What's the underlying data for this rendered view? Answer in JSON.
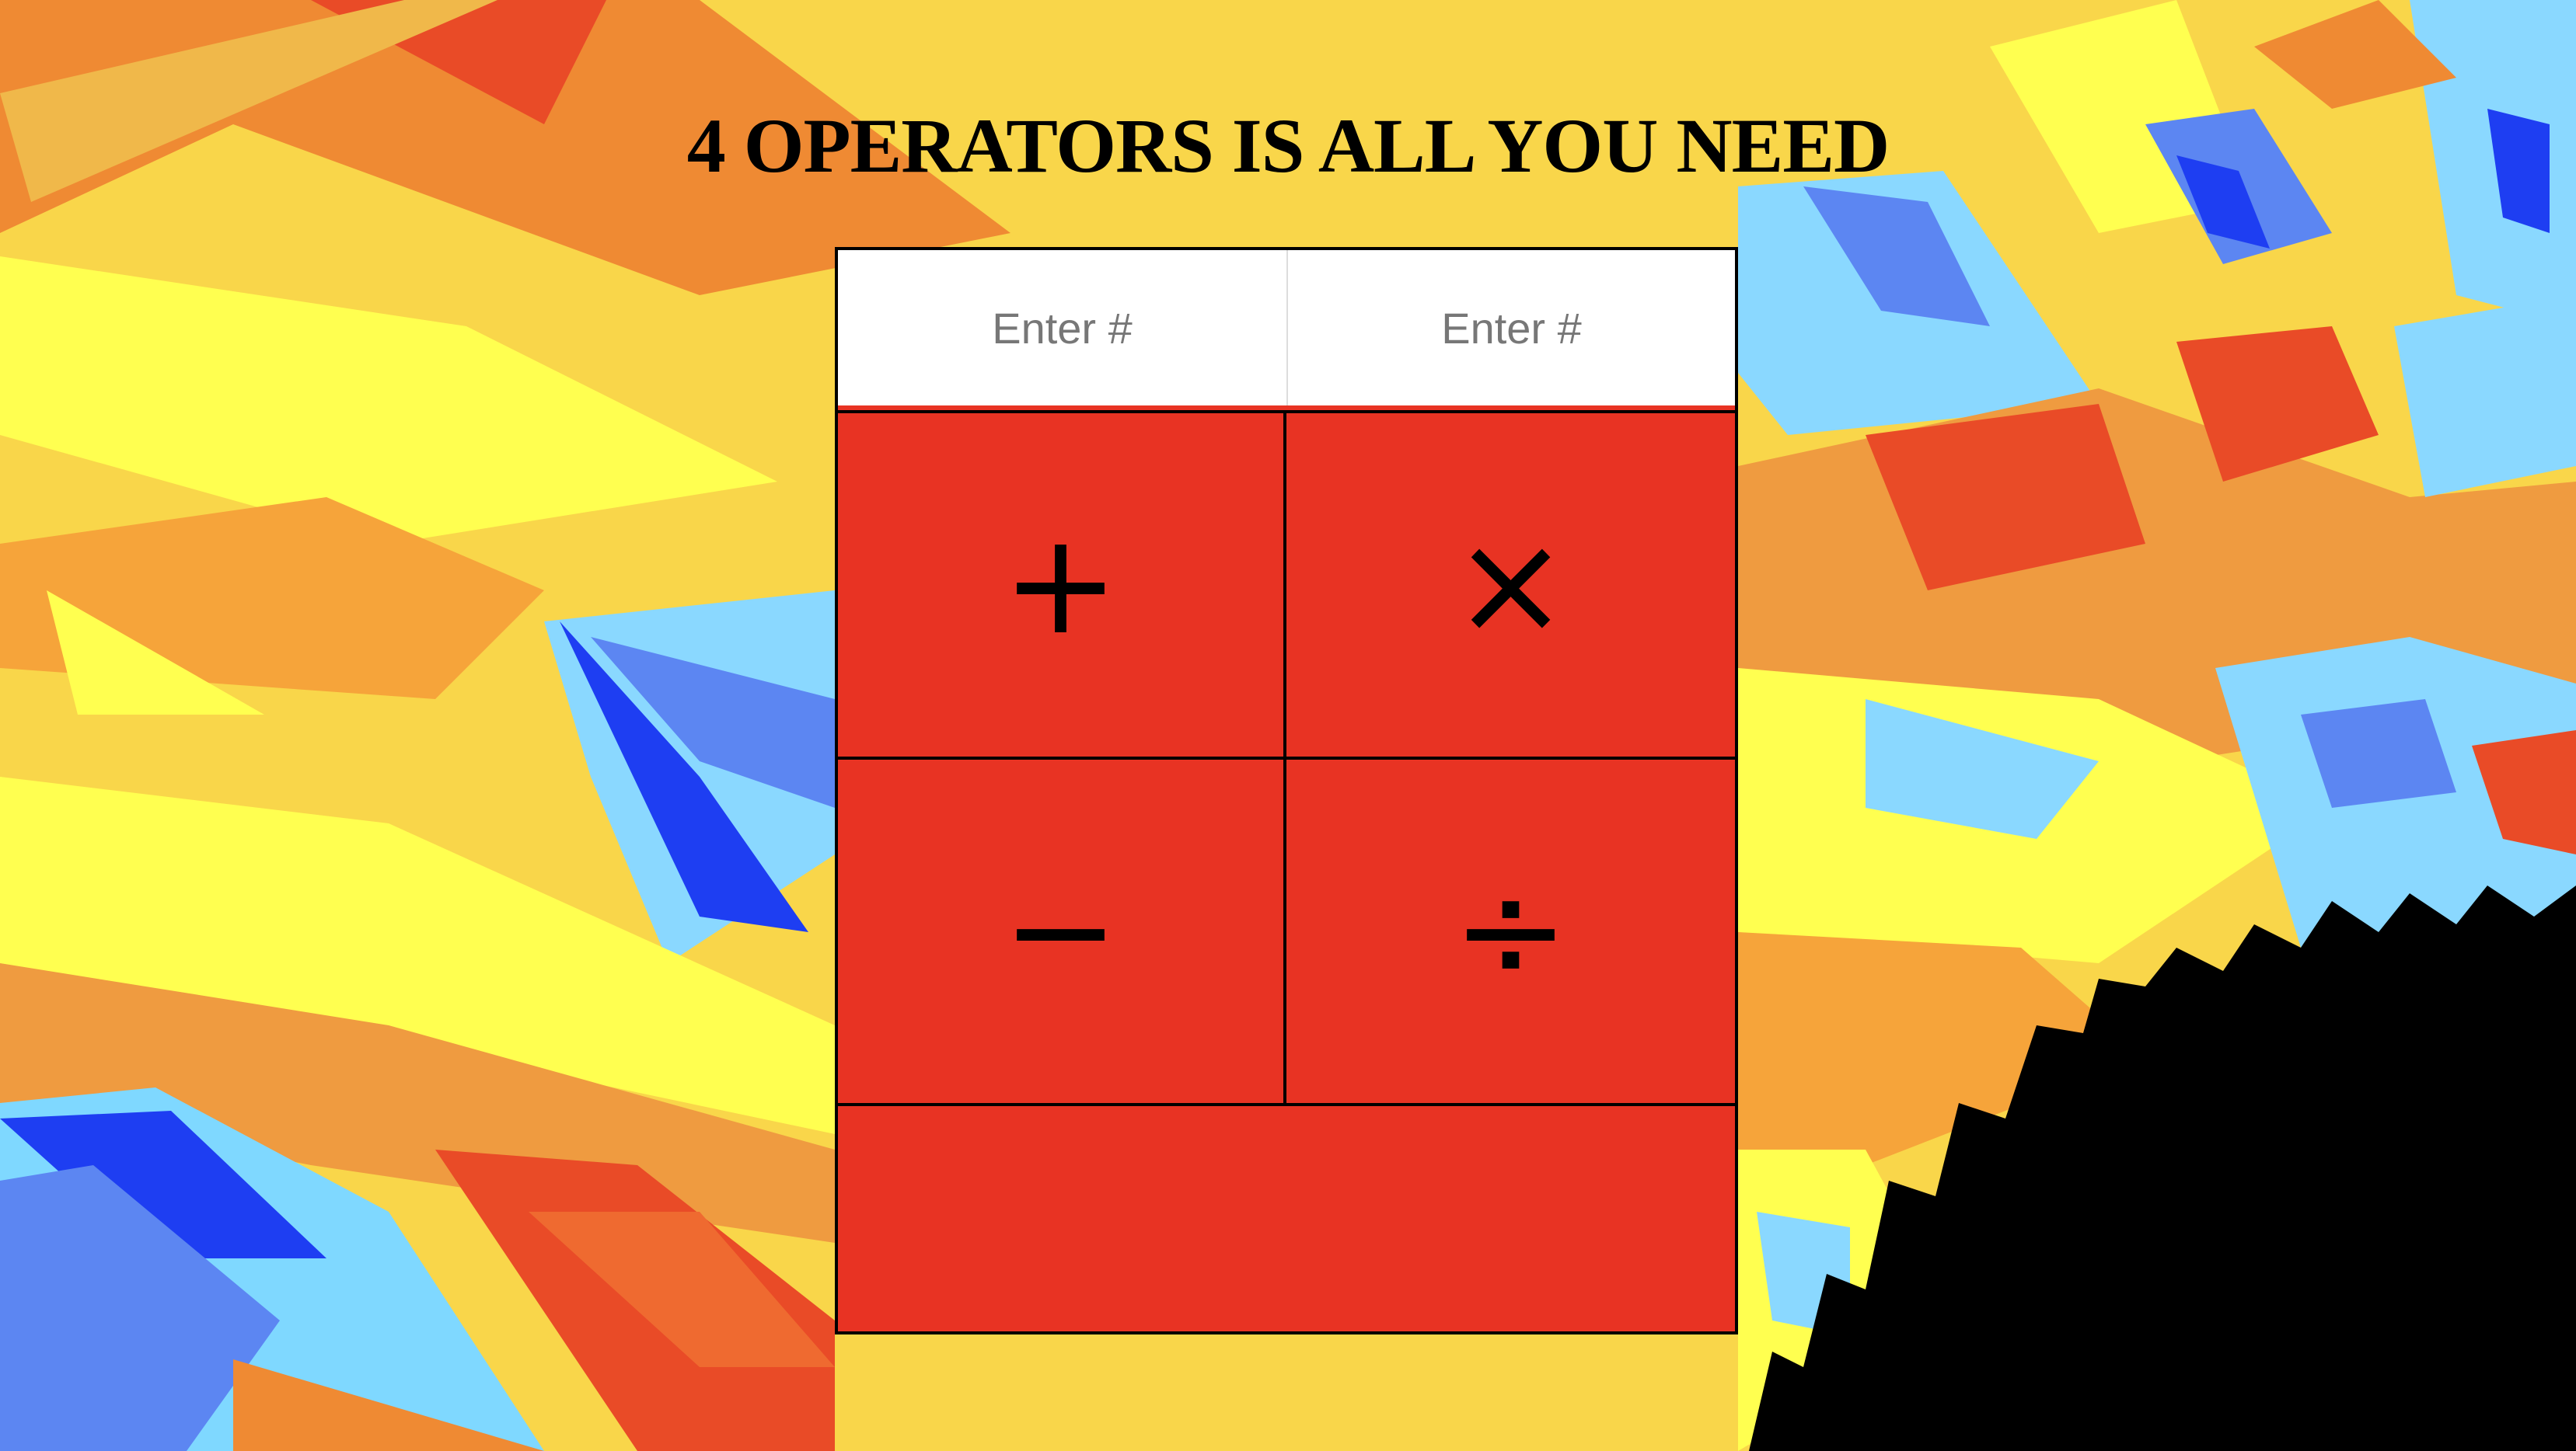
{
  "page": {
    "title": "4 OPERATORS IS ALL YOU NEED"
  },
  "calculator": {
    "inputs": [
      {
        "placeholder": "Enter #",
        "value": ""
      },
      {
        "placeholder": "Enter #",
        "value": ""
      }
    ],
    "operators": [
      {
        "symbol": "+",
        "icon": "plus-icon"
      },
      {
        "symbol": "×",
        "icon": "multiply-icon"
      },
      {
        "symbol": "−",
        "icon": "minus-icon"
      },
      {
        "symbol": "÷",
        "icon": "divide-icon"
      }
    ],
    "result": ""
  },
  "colors": {
    "calculator_red": "#e83323",
    "border": "#000000",
    "input_bg": "#ffffff",
    "placeholder": "#777777"
  }
}
